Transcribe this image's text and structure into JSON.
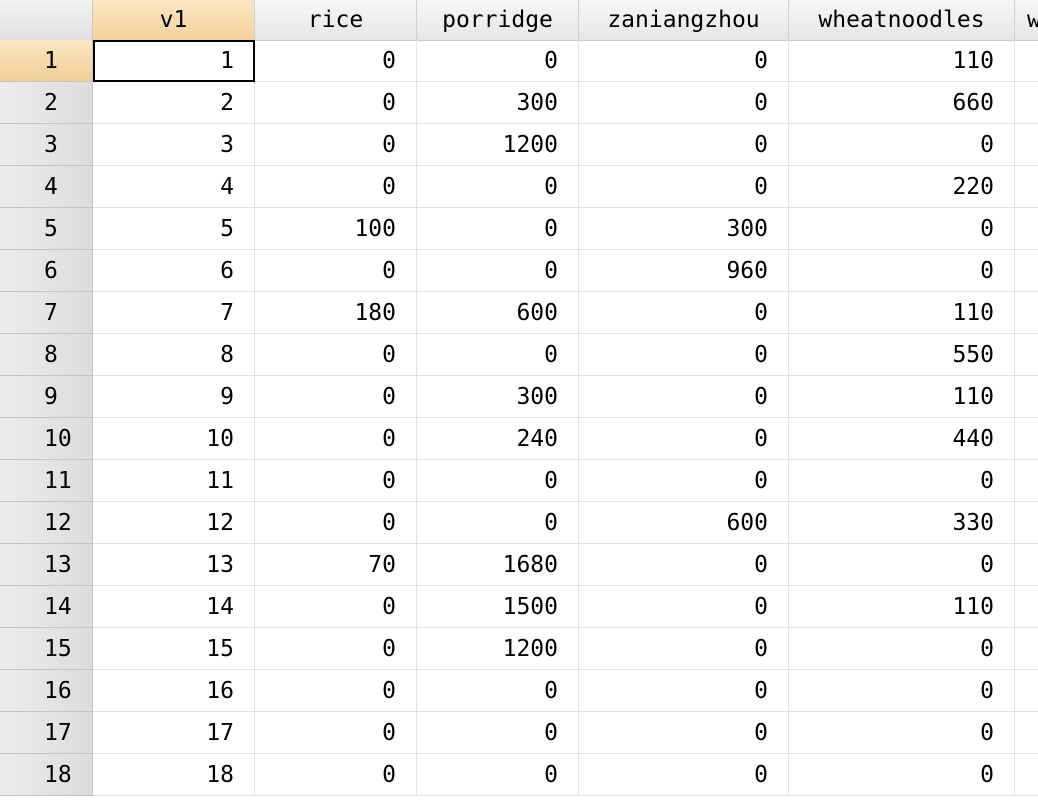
{
  "columns": [
    "v1",
    "rice",
    "porridge",
    "zaniangzhou",
    "wheatnoodles",
    "w"
  ],
  "rows": [
    {
      "num": "1",
      "v1": "1",
      "rice": "0",
      "porridge": "0",
      "zaniangzhou": "0",
      "wheatnoodles": "110"
    },
    {
      "num": "2",
      "v1": "2",
      "rice": "0",
      "porridge": "300",
      "zaniangzhou": "0",
      "wheatnoodles": "660"
    },
    {
      "num": "3",
      "v1": "3",
      "rice": "0",
      "porridge": "1200",
      "zaniangzhou": "0",
      "wheatnoodles": "0"
    },
    {
      "num": "4",
      "v1": "4",
      "rice": "0",
      "porridge": "0",
      "zaniangzhou": "0",
      "wheatnoodles": "220"
    },
    {
      "num": "5",
      "v1": "5",
      "rice": "100",
      "porridge": "0",
      "zaniangzhou": "300",
      "wheatnoodles": "0"
    },
    {
      "num": "6",
      "v1": "6",
      "rice": "0",
      "porridge": "0",
      "zaniangzhou": "960",
      "wheatnoodles": "0"
    },
    {
      "num": "7",
      "v1": "7",
      "rice": "180",
      "porridge": "600",
      "zaniangzhou": "0",
      "wheatnoodles": "110"
    },
    {
      "num": "8",
      "v1": "8",
      "rice": "0",
      "porridge": "0",
      "zaniangzhou": "0",
      "wheatnoodles": "550"
    },
    {
      "num": "9",
      "v1": "9",
      "rice": "0",
      "porridge": "300",
      "zaniangzhou": "0",
      "wheatnoodles": "110"
    },
    {
      "num": "10",
      "v1": "10",
      "rice": "0",
      "porridge": "240",
      "zaniangzhou": "0",
      "wheatnoodles": "440"
    },
    {
      "num": "11",
      "v1": "11",
      "rice": "0",
      "porridge": "0",
      "zaniangzhou": "0",
      "wheatnoodles": "0"
    },
    {
      "num": "12",
      "v1": "12",
      "rice": "0",
      "porridge": "0",
      "zaniangzhou": "600",
      "wheatnoodles": "330"
    },
    {
      "num": "13",
      "v1": "13",
      "rice": "70",
      "porridge": "1680",
      "zaniangzhou": "0",
      "wheatnoodles": "0"
    },
    {
      "num": "14",
      "v1": "14",
      "rice": "0",
      "porridge": "1500",
      "zaniangzhou": "0",
      "wheatnoodles": "110"
    },
    {
      "num": "15",
      "v1": "15",
      "rice": "0",
      "porridge": "1200",
      "zaniangzhou": "0",
      "wheatnoodles": "0"
    },
    {
      "num": "16",
      "v1": "16",
      "rice": "0",
      "porridge": "0",
      "zaniangzhou": "0",
      "wheatnoodles": "0"
    },
    {
      "num": "17",
      "v1": "17",
      "rice": "0",
      "porridge": "0",
      "zaniangzhou": "0",
      "wheatnoodles": "0"
    },
    {
      "num": "18",
      "v1": "18",
      "rice": "0",
      "porridge": "0",
      "zaniangzhou": "0",
      "wheatnoodles": "0"
    }
  ],
  "selection": {
    "row": 1,
    "column": "v1"
  },
  "colors": {
    "header_bg": "#e8e8e8",
    "active_header": "#f3d29a",
    "grid_line": "#e2e2e2",
    "cell_text": "#000000"
  }
}
